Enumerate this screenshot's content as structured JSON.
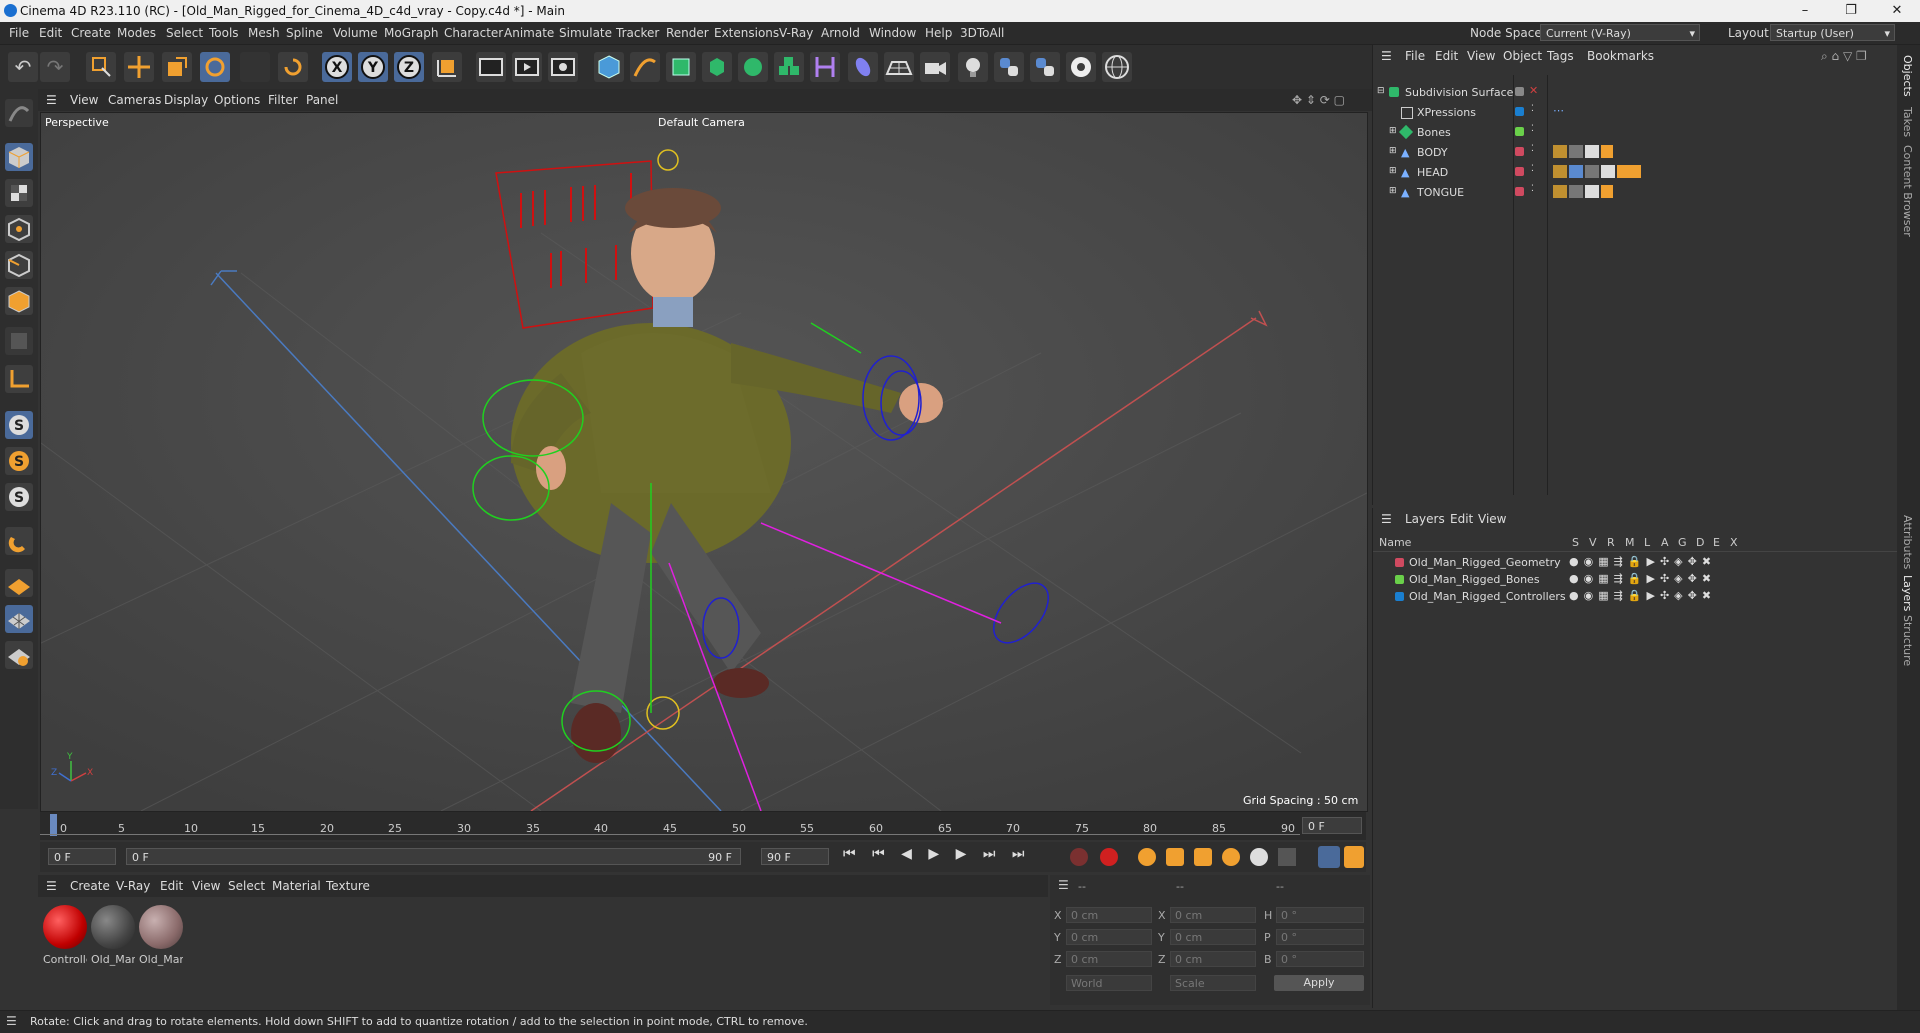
{
  "window": {
    "title": "Cinema 4D R23.110 (RC) - [Old_Man_Rigged_for_Cinema_4D_c4d_vray - Copy.c4d *] - Main",
    "min": "–",
    "max": "❐",
    "close": "✕"
  },
  "menu": [
    "File",
    "Edit",
    "Create",
    "Modes",
    "Select",
    "Tools",
    "Mesh",
    "Spline",
    "Volume",
    "MoGraph",
    "Character",
    "Animate",
    "Simulate",
    "Tracker",
    "Render",
    "Extensions",
    "V-Ray",
    "Arnold",
    "Window",
    "Help",
    "3DToAll"
  ],
  "nodespace": {
    "label": "Node Space:",
    "value": "Current (V-Ray)"
  },
  "layout": {
    "label": "Layout:",
    "value": "Startup (User)"
  },
  "viewport": {
    "menu": [
      "View",
      "Cameras",
      "Display",
      "Options",
      "Filter",
      "Panel"
    ],
    "name": "Perspective",
    "camera": "Default Camera",
    "grid": "Grid Spacing : 50 cm"
  },
  "timeline": {
    "ticks": [
      "0",
      "5",
      "10",
      "15",
      "20",
      "25",
      "30",
      "35",
      "40",
      "45",
      "50",
      "55",
      "60",
      "65",
      "70",
      "75",
      "80",
      "85",
      "90"
    ],
    "current": "0 F"
  },
  "transport": {
    "start": "0 F",
    "range_start": "0 F",
    "range_end": "90 F",
    "end": "90 F"
  },
  "materials": {
    "menu": [
      "Create",
      "V-Ray",
      "Edit",
      "View",
      "Select",
      "Material",
      "Texture"
    ],
    "items": [
      {
        "label": "Controlle",
        "color": "#d01010"
      },
      {
        "label": "Old_Mar",
        "color": "#555"
      },
      {
        "label": "Old_Mar",
        "color": "#8a7a7a"
      }
    ]
  },
  "coords": {
    "header": [
      "--",
      "--",
      "--"
    ],
    "rows": [
      {
        "a": "X",
        "av": "0 cm",
        "b": "X",
        "bv": "0 cm",
        "c": "H",
        "cv": "0 °"
      },
      {
        "a": "Y",
        "av": "0 cm",
        "b": "Y",
        "bv": "0 cm",
        "c": "P",
        "cv": "0 °"
      },
      {
        "a": "Z",
        "av": "0 cm",
        "b": "Z",
        "bv": "0 cm",
        "c": "B",
        "cv": "0 °"
      }
    ],
    "world": "World",
    "scale": "Scale",
    "apply": "Apply"
  },
  "objects": {
    "menu": [
      "File",
      "Edit",
      "View",
      "Object",
      "Tags",
      "Bookmarks"
    ],
    "items": [
      {
        "name": "Subdivision Surface",
        "color": "#888"
      },
      {
        "name": "XPressions",
        "color": "#1a7fd0"
      },
      {
        "name": "Bones",
        "color": "#6ad04a"
      },
      {
        "name": "BODY",
        "color": "#d04a60"
      },
      {
        "name": "HEAD",
        "color": "#d04a60"
      },
      {
        "name": "TONGUE",
        "color": "#d04a60"
      }
    ]
  },
  "layers": {
    "menu": [
      "Layers",
      "Edit",
      "View"
    ],
    "header": "Name",
    "cols": [
      "S",
      "V",
      "R",
      "M",
      "L",
      "A",
      "G",
      "D",
      "E",
      "X"
    ],
    "items": [
      {
        "name": "Old_Man_Rigged_Geometry",
        "color": "#d04a60"
      },
      {
        "name": "Old_Man_Rigged_Bones",
        "color": "#6ad04a"
      },
      {
        "name": "Old_Man_Rigged_Controllers",
        "color": "#1a7fd0"
      }
    ]
  },
  "sidetabs": [
    "Objects",
    "Takes",
    "Content Browser",
    "Attributes",
    "Layers",
    "Structure"
  ],
  "status": "Rotate: Click and drag to rotate elements. Hold down SHIFT to add to quantize rotation / add to the selection in point mode, CTRL to remove."
}
